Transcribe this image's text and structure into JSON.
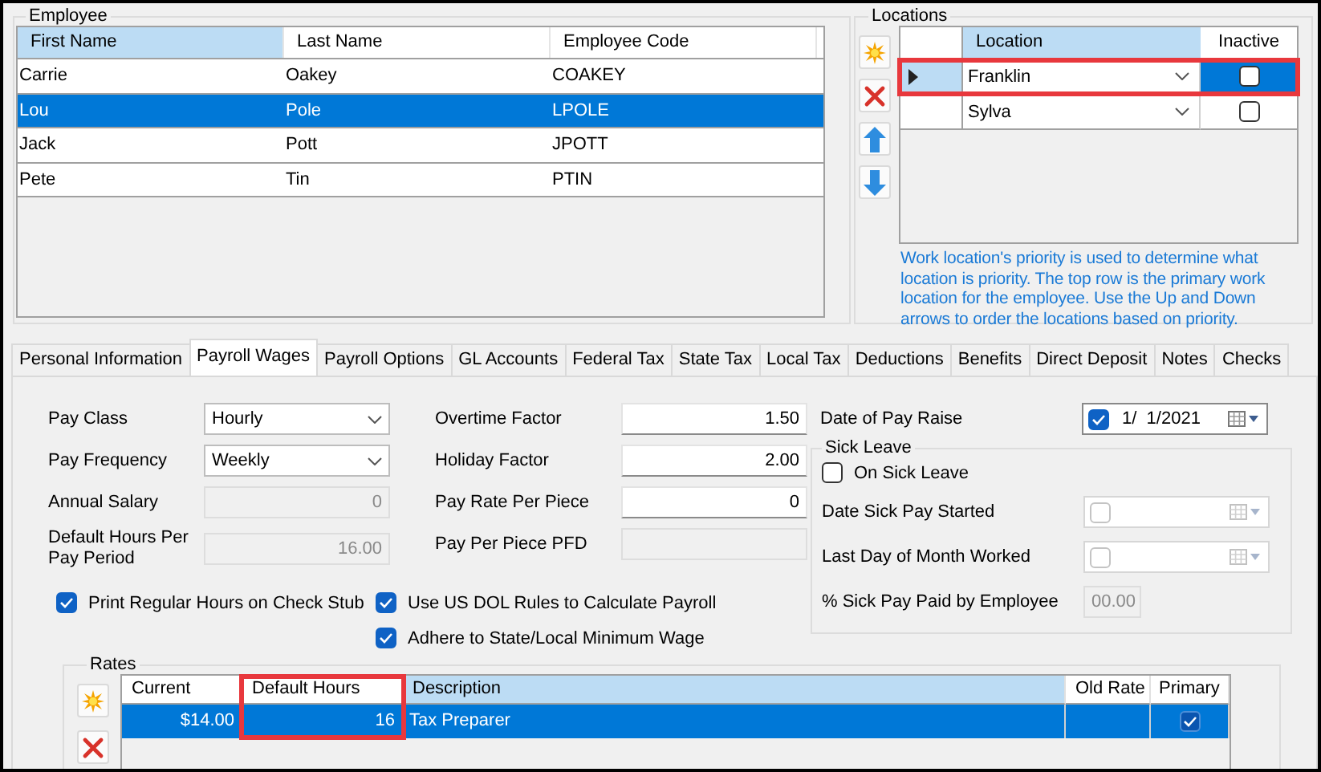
{
  "employee_panel": {
    "title": "Employee",
    "columns": [
      {
        "label": "First Name",
        "selected": true
      },
      {
        "label": "Last Name",
        "selected": false
      },
      {
        "label": "Employee Code",
        "selected": false
      }
    ],
    "rows": [
      {
        "cells": [
          "Carrie",
          "Oakey",
          "COAKEY"
        ],
        "selected": false
      },
      {
        "cells": [
          "Lou",
          "Pole",
          "LPOLE"
        ],
        "selected": true
      },
      {
        "cells": [
          "Jack",
          "Pott",
          "JPOTT"
        ],
        "selected": false
      },
      {
        "cells": [
          "Pete",
          "Tin",
          "PTIN"
        ],
        "selected": false
      }
    ]
  },
  "locations_panel": {
    "title": "Locations",
    "columns": [
      {
        "label": "Location",
        "selected": true
      },
      {
        "label": "Inactive",
        "selected": false
      }
    ],
    "rows": [
      {
        "location": "Franklin",
        "inactive": false,
        "selected": true,
        "highlighted": true
      },
      {
        "location": "Sylva",
        "inactive": false,
        "selected": false,
        "highlighted": false
      }
    ],
    "note": "Work location's priority is used to determine what location is priority. The top row is the primary work location for the employee. Use the Up and Down arrows to order the locations based on priority."
  },
  "tabs": [
    {
      "label": "Personal Information",
      "selected": false
    },
    {
      "label": "Payroll Wages",
      "selected": true
    },
    {
      "label": "Payroll Options",
      "selected": false
    },
    {
      "label": "GL Accounts",
      "selected": false
    },
    {
      "label": "Federal Tax",
      "selected": false
    },
    {
      "label": "State Tax",
      "selected": false
    },
    {
      "label": "Local Tax",
      "selected": false
    },
    {
      "label": "Deductions",
      "selected": false
    },
    {
      "label": "Benefits",
      "selected": false
    },
    {
      "label": "Direct Deposit",
      "selected": false
    },
    {
      "label": "Notes",
      "selected": false
    },
    {
      "label": "Checks",
      "selected": false
    }
  ],
  "payroll_wages": {
    "left_fields": [
      {
        "label": "Pay Class",
        "kind": "dropdown",
        "value": "Hourly",
        "disabled": false
      },
      {
        "label": "Pay Frequency",
        "kind": "dropdown",
        "value": "Weekly",
        "disabled": false
      },
      {
        "label": "Annual Salary",
        "kind": "number",
        "value": "0",
        "disabled": true
      },
      {
        "label": "Default Hours Per Pay Period",
        "kind": "number",
        "value": "16.00",
        "disabled": true
      }
    ],
    "middle_fields": [
      {
        "label": "Overtime Factor",
        "kind": "number",
        "value": "1.50",
        "disabled": false
      },
      {
        "label": "Holiday Factor",
        "kind": "number",
        "value": "2.00",
        "disabled": false
      },
      {
        "label": "Pay Rate Per Piece",
        "kind": "number",
        "value": "0",
        "disabled": false
      },
      {
        "label": "Pay Per Piece PFD",
        "kind": "number",
        "disabled": true
      }
    ],
    "left_options": [
      {
        "label": "Print Regular Hours on Check Stub",
        "checked": true
      }
    ],
    "middle_options": [
      {
        "label": "Use US DOL Rules to Calculate Payroll",
        "checked": true
      },
      {
        "label": "Adhere to State/Local Minimum Wage",
        "checked": true
      }
    ],
    "pay_raise": {
      "label": "Date of Pay Raise",
      "checked": true,
      "value": "1/  1/2021",
      "disabled": false
    },
    "sick_leave": {
      "title": "Sick Leave",
      "on_sick_leave": {
        "label": "On Sick Leave",
        "checked": false
      },
      "fields": [
        {
          "label": "Date Sick Pay Started",
          "kind": "date",
          "checked": false,
          "disabled": true
        },
        {
          "label": "Last Day of Month Worked",
          "kind": "date",
          "checked": false,
          "disabled": true
        },
        {
          "label": "% Sick Pay Paid by Employee",
          "kind": "number",
          "value": "00.00",
          "disabled": true
        }
      ]
    },
    "rates": {
      "title": "Rates",
      "columns": [
        {
          "label": "Current",
          "selected": false,
          "highlighted": false
        },
        {
          "label": "Default Hours",
          "selected": false,
          "highlighted": true
        },
        {
          "label": "Description",
          "selected": true,
          "highlighted": false
        },
        {
          "label": "Old Rate",
          "selected": false,
          "highlighted": false
        },
        {
          "label": "Primary",
          "selected": false,
          "highlighted": false
        }
      ],
      "rows": [
        {
          "current": "$14.00",
          "default_hours": "16",
          "description": "Tax Preparer",
          "primary": true,
          "selected": true
        }
      ]
    }
  }
}
